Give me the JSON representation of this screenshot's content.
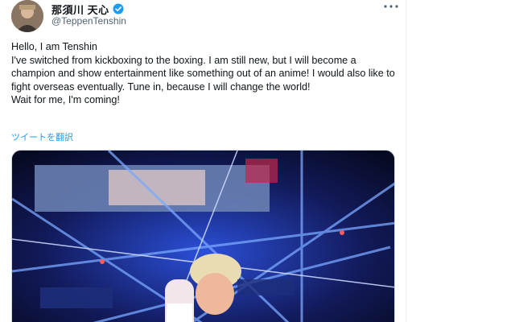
{
  "author": {
    "display_name": "那須川 天心",
    "handle": "@TeppenTenshin",
    "verified": true
  },
  "tweet": {
    "lines": [
      "Hello, I am Tenshin",
      "I've switched from kickboxing to the boxing. I am still new, but I will become a champion and show entertainment like something out of an anime! I would also like to fight overseas eventually. Tune in, because I will change the world!",
      "Wait for me, I'm coming!"
    ],
    "translate_label": "ツイートを翻訳"
  },
  "icons": {
    "verified": "verified-badge-icon",
    "more": "more-options-icon"
  },
  "colors": {
    "link": "#1d9bf0",
    "secondary_text": "#536471",
    "media_bg": "#0b0f2a"
  }
}
